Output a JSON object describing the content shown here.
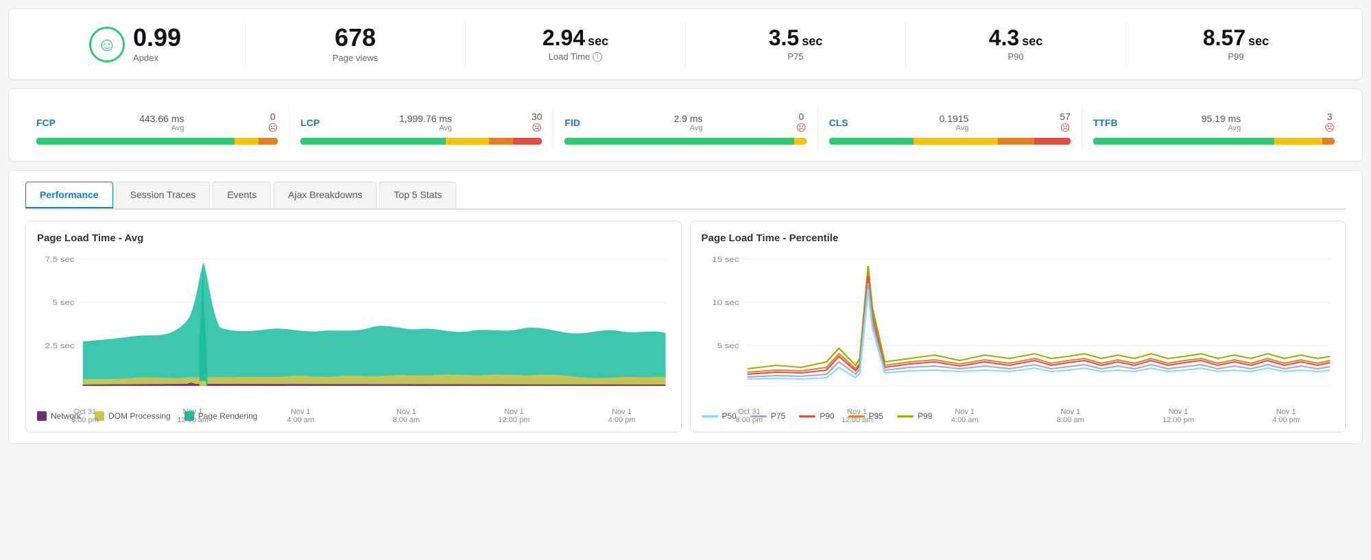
{
  "top_stats": {
    "apdex": {
      "value": "0.99",
      "label": "Apdex"
    },
    "page_views": {
      "value": "678",
      "label": "Page views"
    },
    "load_time": {
      "value": "2.94",
      "unit": "sec",
      "label": "Load Time"
    },
    "p75": {
      "value": "3.5",
      "unit": "sec",
      "label": "P75"
    },
    "p90": {
      "value": "4.3",
      "unit": "sec",
      "label": "P90"
    },
    "p99": {
      "value": "8.57",
      "unit": "sec",
      "label": "P99"
    }
  },
  "vitals": [
    {
      "name": "FCP",
      "avg": "443.66 ms",
      "count": "0"
    },
    {
      "name": "LCP",
      "avg": "1,999.76 ms",
      "count": "30"
    },
    {
      "name": "FID",
      "avg": "2.9 ms",
      "count": "0"
    },
    {
      "name": "CLS",
      "avg": "0.1915",
      "count": "57"
    },
    {
      "name": "TTFB",
      "avg": "95.19 ms",
      "count": "3"
    }
  ],
  "tabs": [
    {
      "id": "performance",
      "label": "Performance",
      "active": true
    },
    {
      "id": "session-traces",
      "label": "Session Traces",
      "active": false
    },
    {
      "id": "events",
      "label": "Events",
      "active": false
    },
    {
      "id": "ajax-breakdowns",
      "label": "Ajax Breakdowns",
      "active": false
    },
    {
      "id": "top-5-stats",
      "label": "Top 5 Stats",
      "active": false
    }
  ],
  "chart_avg": {
    "title": "Page Load Time - Avg",
    "y_labels": [
      "7.5 sec",
      "5 sec",
      "2.5 sec"
    ],
    "x_labels": [
      "Oct 31\n8:00 pm",
      "Nov 1\n12:00 am",
      "Nov 1\n4:00 am",
      "Nov 1\n8:00 am",
      "Nov 1\n12:00 pm",
      "Nov 1\n4:00 pm"
    ]
  },
  "chart_percentile": {
    "title": "Page Load Time - Percentile",
    "y_labels": [
      "15 sec",
      "10 sec",
      "5 sec"
    ],
    "x_labels": [
      "Oct 31\n8:00 pm",
      "Nov 1\n12:00 am",
      "Nov 1\n4:00 am",
      "Nov 1\n8:00 am",
      "Nov 1\n12:00 pm",
      "Nov 1\n4:00 pm"
    ]
  },
  "legend_avg": [
    {
      "label": "Network",
      "color": "#6b2d6b"
    },
    {
      "label": "DOM Processing",
      "color": "#d4c44f"
    },
    {
      "label": "Page Rendering",
      "color": "#1abc9c"
    }
  ],
  "legend_percentile": [
    {
      "label": "P50",
      "color": "#7fdbff"
    },
    {
      "label": "P75",
      "color": "#b09fcc"
    },
    {
      "label": "P90",
      "color": "#e74c3c"
    },
    {
      "label": "P95",
      "color": "#e67e22"
    },
    {
      "label": "P99",
      "color": "#8db600"
    }
  ]
}
